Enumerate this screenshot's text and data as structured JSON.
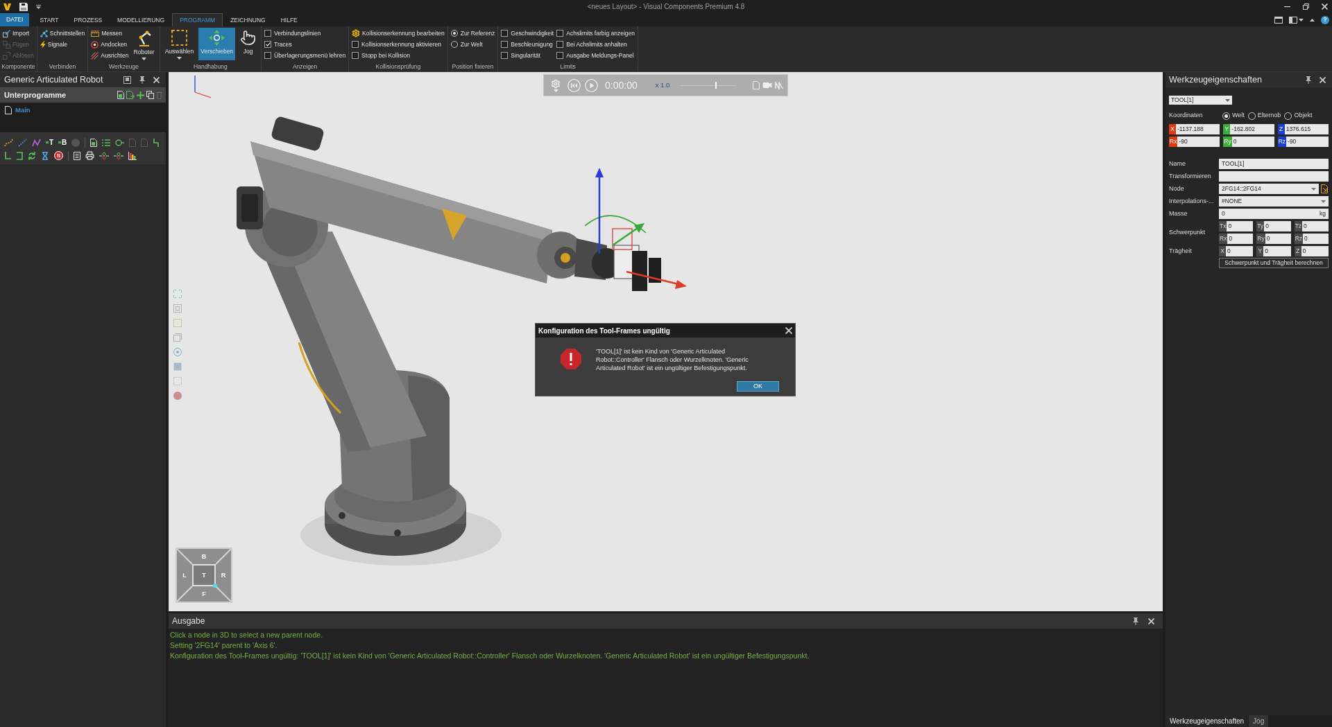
{
  "title_bar": {
    "title": "<neues Layout> - Visual Components Premium 4.8"
  },
  "menu": {
    "file": "DATEI",
    "tabs": [
      {
        "label": "START",
        "selected": false
      },
      {
        "label": "PROZESS",
        "selected": false
      },
      {
        "label": "MODELLIERUNG",
        "selected": false
      },
      {
        "label": "PROGRAMM",
        "selected": true
      },
      {
        "label": "ZEICHNUNG",
        "selected": false
      },
      {
        "label": "HILFE",
        "selected": false
      }
    ],
    "help": "?"
  },
  "ribbon": [
    {
      "label": "Komponente",
      "items": [
        {
          "kind": "small",
          "label": "Import",
          "disabled": false
        },
        {
          "kind": "small",
          "label": "Fügen",
          "disabled": true
        },
        {
          "kind": "small",
          "label": "Ablösen",
          "disabled": true
        }
      ]
    },
    {
      "label": "Verbinden",
      "items": [
        {
          "kind": "small",
          "label": "Schnittstellen",
          "disabled": false
        },
        {
          "kind": "small",
          "label": "Signale",
          "disabled": false
        }
      ]
    },
    {
      "label": "Werkzeuge",
      "items": [
        {
          "kind": "small",
          "label": "Messen",
          "disabled": false
        },
        {
          "kind": "small",
          "label": "Andocken",
          "disabled": false
        },
        {
          "kind": "small",
          "label": "Ausrichten",
          "disabled": false
        },
        {
          "kind": "large",
          "label": "Roboter",
          "selected": false,
          "dropdown": true
        }
      ]
    },
    {
      "label": "Handhabung",
      "items": [
        {
          "kind": "large",
          "label": "Auswählen",
          "selected": false,
          "dropdown": true
        },
        {
          "kind": "large",
          "label": "Verschieben",
          "selected": true,
          "dropdown": false
        },
        {
          "kind": "large",
          "label": "Jog",
          "selected": false,
          "dropdown": false
        }
      ]
    },
    {
      "label": "Anzeigen",
      "items": [
        {
          "kind": "check",
          "label": "Verbindungslinien",
          "checked": false
        },
        {
          "kind": "check",
          "label": "Traces",
          "checked": true
        },
        {
          "kind": "check",
          "label": "Überlagerungsmenü lehren",
          "checked": false
        }
      ]
    },
    {
      "label": "Kollisionsprüfung",
      "items": [
        {
          "kind": "small",
          "label": "Kollisionserkennung bearbeiten",
          "disabled": false
        },
        {
          "kind": "check",
          "label": "Kollisionserkennung aktivieren",
          "checked": false
        },
        {
          "kind": "check",
          "label": "Stopp bei Kollision",
          "checked": false
        }
      ]
    },
    {
      "label": "Position fixieren",
      "items": [
        {
          "kind": "radio",
          "label": "Zur Referenz",
          "selected": true
        },
        {
          "kind": "radio",
          "label": "Zur Welt",
          "selected": false
        }
      ]
    },
    {
      "label": "Limits",
      "items": [
        {
          "kind": "check",
          "label": "Geschwindigkeit",
          "checked": false
        },
        {
          "kind": "check",
          "label": "Beschleunigung",
          "checked": false
        },
        {
          "kind": "check",
          "label": "Singularität",
          "checked": false
        },
        {
          "kind": "check",
          "label": "Achslimits farbig anzeigen",
          "checked": false
        },
        {
          "kind": "check",
          "label": "Bei Achslimits anhalten",
          "checked": false
        },
        {
          "kind": "check",
          "label": "Ausgabe Meldungs-Panel",
          "checked": false
        }
      ]
    }
  ],
  "left_panel": {
    "title": "Generic Articulated Robot",
    "section": "Unterprogramme",
    "routines": [
      {
        "label": "Main",
        "selected": true
      }
    ],
    "toolbar_letters": [
      "T",
      "B",
      "S"
    ]
  },
  "viewport": {
    "playback": {
      "time": "0:00:00",
      "speed": "x 1.0",
      "speed_slider": {
        "level": 0.62
      }
    },
    "nav_cube": {
      "top": "B",
      "left": "L",
      "center": "T",
      "right": "R",
      "bottom": "F"
    }
  },
  "dialog": {
    "title": "Konfiguration des Tool-Frames ungültig",
    "message": "'TOOL[1]' ist kein Kind von 'Generic Articulated Robot::Controller' Flansch oder Wurzelknoten. 'Generic Articulated Robot' ist ein ungültiger Befestigungspunkt.",
    "button": "OK"
  },
  "output": {
    "title": "Ausgabe",
    "lines": [
      "Click a node in 3D to select a new parent node.",
      "Setting '2FG14' parent to 'Axis 6'.",
      "Konfiguration des Tool-Frames ungültig: 'TOOL[1]' ist kein Kind von 'Generic Articulated Robot::Controller' Flansch oder Wurzelknoten. 'Generic Articulated Robot' ist ein ungültiger Befestigungspunkt."
    ]
  },
  "right_panel": {
    "title": "Werkzeugeigenschaften",
    "tool": "TOOL[1]",
    "coordinates_label": "Koordinaten",
    "coord_modes": [
      {
        "label": "Welt",
        "selected": true
      },
      {
        "label": "Elternob",
        "selected": false
      },
      {
        "label": "Objekt",
        "selected": false
      }
    ],
    "position": [
      {
        "axis": "X",
        "value": "-1137.188",
        "color": "#e03a12"
      },
      {
        "axis": "Y",
        "value": "-162.802",
        "color": "#3cae3a"
      },
      {
        "axis": "Z",
        "value": "1376.615",
        "color": "#1a3fd0"
      }
    ],
    "rotation": [
      {
        "axis": "Rx",
        "value": "-90",
        "color": "#e03a12"
      },
      {
        "axis": "Ry",
        "value": "0",
        "color": "#3cae3a"
      },
      {
        "axis": "Rz",
        "value": "-90",
        "color": "#1a3fd0"
      }
    ],
    "properties": [
      {
        "kind": "text",
        "label": "Name",
        "value": "TOOL[1]"
      },
      {
        "kind": "text",
        "label": "Transformieren"
      },
      {
        "kind": "select",
        "label": "Node",
        "value": "2FG14::2FG14",
        "picker": true
      },
      {
        "kind": "select",
        "label": "Interpolations-...",
        "value": "#NONE"
      },
      {
        "kind": "unit",
        "label": "Masse",
        "value": "0",
        "unit": "kg"
      }
    ],
    "center_of_mass": {
      "label": "Schwerpunkt",
      "fields": [
        {
          "axis": "Tx",
          "value": "0"
        },
        {
          "axis": "Ty",
          "value": "0"
        },
        {
          "axis": "Tz",
          "value": "0"
        },
        {
          "axis": "Rx",
          "value": "0"
        },
        {
          "axis": "Ry",
          "value": "0"
        },
        {
          "axis": "Rz",
          "value": "0"
        }
      ]
    },
    "inertia": {
      "label": "Trägheit",
      "fields": [
        {
          "axis": "X",
          "value": "0"
        },
        {
          "axis": "Y",
          "value": "0"
        },
        {
          "axis": "Z",
          "value": "0"
        }
      ]
    },
    "compute_button": "Schwerpunkt und Trägheit berechnen",
    "bottom_tabs": [
      {
        "label": "Werkzeugeigenschaften",
        "selected": true
      },
      {
        "label": "Jog",
        "selected": false
      }
    ]
  }
}
